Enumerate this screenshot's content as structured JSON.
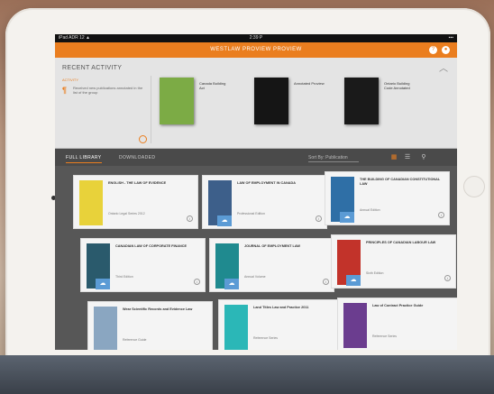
{
  "status_bar": {
    "carrier": "iPad  ADR 12 ▲",
    "time": "2:39 P",
    "battery": "▪▪▪"
  },
  "app": {
    "title": "WESTLAW PROVIEW PROVIEW"
  },
  "recent_activity": {
    "heading": "RECENT ACTIVITY",
    "label": "ACTIVITY",
    "text": "Received new publications annotated in the list of the group",
    "books": [
      {
        "title": "Canada Building Act",
        "cover_color": "#7cab45"
      },
      {
        "title": "Annotated Proview",
        "cover_color": "#151515"
      },
      {
        "title": "Ontario Building Code Annotated",
        "cover_color": "#1a1a1a"
      }
    ]
  },
  "tabs": [
    {
      "label": "FULL LIBRARY",
      "active": true
    },
    {
      "label": "DOWNLOADED",
      "active": false
    }
  ],
  "sort_label": "Sort By: Publication",
  "library_cards": [
    {
      "title": "ENGLISH - THE LAW OF EVIDENCE",
      "meta": "Ontario Legal Series 2012",
      "cover_color": "#e8d23a"
    },
    {
      "title": "LAW OF EMPLOYMENT IN CANADA",
      "meta": "Professional Edition",
      "cover_color": "#3d5f8a"
    },
    {
      "title": "THE BUILDING OF CANADIAN CONSTITUTIONAL LAW",
      "meta": "Annual Edition",
      "cover_color": "#2f6fa6"
    },
    {
      "title": "CANADIAN LAW OF CORPORATE FINANCE",
      "meta": "Third Edition",
      "cover_color": "#2a5a6c"
    },
    {
      "title": "JOURNAL OF EMPLOYMENT LAW",
      "meta": "Annual Volume",
      "cover_color": "#1f8a8f"
    },
    {
      "title": "PRINCIPLES OF CANADIAN LABOUR LAW",
      "meta": "Sixth Edition",
      "cover_color": "#c2332a"
    },
    {
      "title": "Wear Scientific Records and Evidence Law",
      "meta": "Reference Guide",
      "cover_color": "#8aa6c1"
    },
    {
      "title": "Land Titles Law and Practice 2011",
      "meta": "Reference Series",
      "cover_color": "#2bb7b7"
    },
    {
      "title": "Law of Contract Practice Guide",
      "meta": "Reference Series",
      "cover_color": "#6b3d8f"
    }
  ],
  "colors": {
    "accent": "#ea7e1f",
    "cloud": "#5b9bd5"
  }
}
